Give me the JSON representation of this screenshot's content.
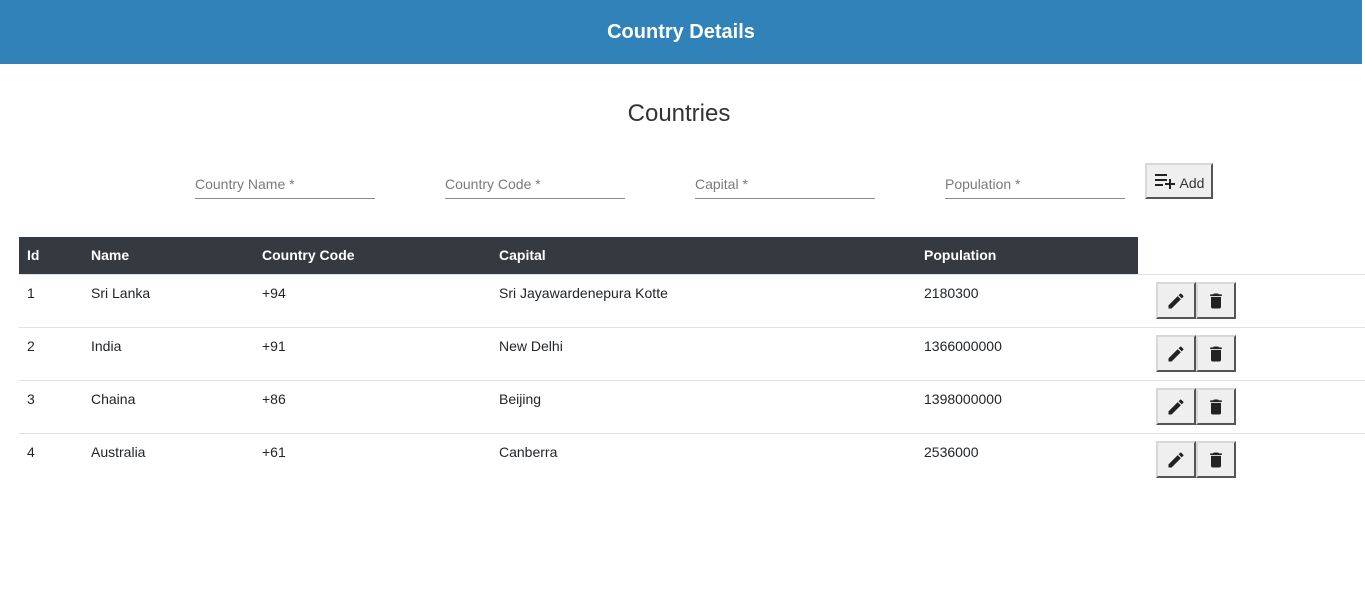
{
  "header": {
    "title": "Country Details"
  },
  "page": {
    "heading": "Countries"
  },
  "form": {
    "country_name_placeholder": "Country Name *",
    "country_code_placeholder": "Country Code *",
    "capital_placeholder": "Capital *",
    "population_placeholder": "Population *",
    "add_label": "Add",
    "add_icon": "playlist-add-icon"
  },
  "table": {
    "columns": [
      "Id",
      "Name",
      "Country Code",
      "Capital",
      "Population"
    ],
    "rows": [
      {
        "id": "1",
        "name": "Sri Lanka",
        "code": "+94",
        "capital": "Sri Jayawardenepura Kotte",
        "population": "2180300"
      },
      {
        "id": "2",
        "name": "India",
        "code": "+91",
        "capital": "New Delhi",
        "population": "1366000000"
      },
      {
        "id": "3",
        "name": "Chaina",
        "code": "+86",
        "capital": "Beijing",
        "population": "1398000000"
      },
      {
        "id": "4",
        "name": "Australia",
        "code": "+61",
        "capital": "Canberra",
        "population": "2536000"
      }
    ],
    "row_actions": [
      "edit-icon",
      "delete-icon"
    ]
  },
  "colors": {
    "header_bg": "#3182b8",
    "table_header_bg": "#343a40"
  }
}
